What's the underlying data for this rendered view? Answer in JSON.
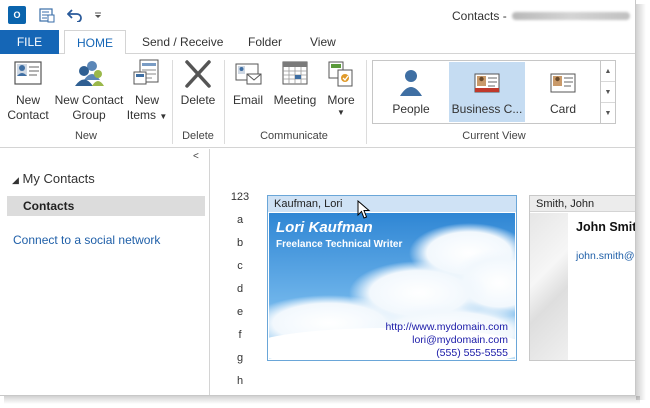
{
  "window": {
    "title": "Contacts - "
  },
  "quick_access": {
    "app_icon": "outlook-icon",
    "buttons": [
      "send-receive-all-icon",
      "undo-icon",
      "customize-qat-icon"
    ]
  },
  "tabs": [
    {
      "label": "FILE",
      "active": false
    },
    {
      "label": "HOME",
      "active": true
    },
    {
      "label": "Send / Receive",
      "active": false
    },
    {
      "label": "Folder",
      "active": false
    },
    {
      "label": "View",
      "active": false
    }
  ],
  "ribbon": {
    "new_group": {
      "label": "New",
      "new_contact": "New\nContact",
      "new_contact_l1": "New",
      "new_contact_l2": "Contact",
      "new_contact_group_l1": "New Contact",
      "new_contact_group_l2": "Group",
      "new_items_l1": "New",
      "new_items_l2": "Items"
    },
    "delete_group": {
      "label": "Delete",
      "delete": "Delete"
    },
    "communicate_group": {
      "label": "Communicate",
      "email": "Email",
      "meeting": "Meeting",
      "more": "More"
    },
    "current_view_group": {
      "label": "Current View",
      "views": [
        {
          "label": "People",
          "selected": false
        },
        {
          "label": "Business C...",
          "selected": true
        },
        {
          "label": "Card",
          "selected": false
        }
      ]
    }
  },
  "nav": {
    "my_contacts": "My Contacts",
    "contacts": "Contacts",
    "social": "Connect to a social network"
  },
  "alphabet": [
    "123",
    "a",
    "b",
    "c",
    "d",
    "e",
    "f",
    "g",
    "h"
  ],
  "cards": [
    {
      "file_as": "Kaufman, Lori",
      "name": "Lori Kaufman",
      "job_title": "Freelance Technical Writer",
      "website": "http://www.mydomain.com",
      "email": "lori@mydomain.com",
      "phone": "(555) 555-5555"
    },
    {
      "file_as": "Smith, John",
      "name": "John Smit",
      "email": "john.smith@"
    }
  ],
  "colors": {
    "accent": "#1566b6",
    "card_selected_header": "#cfe2f5",
    "link": "#1f5fa8"
  }
}
